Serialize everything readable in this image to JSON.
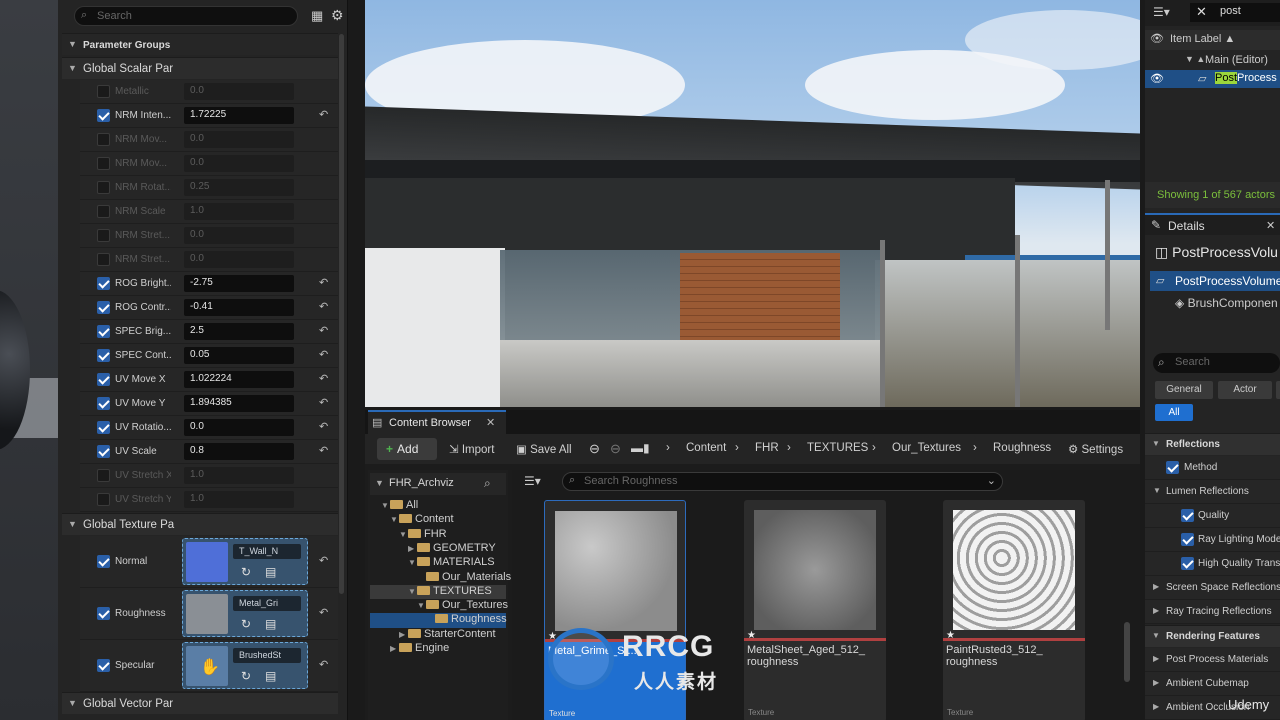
{
  "material_panel": {
    "search_placeholder": "Search",
    "parameter_groups": "Parameter Groups",
    "global_scalar": "Global Scalar Par",
    "global_texture": "Global Texture Pa",
    "global_vector": "Global Vector Par",
    "scalar_params": [
      {
        "label": "Metallic",
        "value": "0.0",
        "enabled": false
      },
      {
        "label": "NRM Inten...",
        "value": "1.72225",
        "enabled": true
      },
      {
        "label": "NRM Mov...",
        "value": "0.0",
        "enabled": false
      },
      {
        "label": "NRM Mov...",
        "value": "0.0",
        "enabled": false
      },
      {
        "label": "NRM Rotat...",
        "value": "0.25",
        "enabled": false
      },
      {
        "label": "NRM Scale",
        "value": "1.0",
        "enabled": false
      },
      {
        "label": "NRM Stret...",
        "value": "0.0",
        "enabled": false
      },
      {
        "label": "NRM Stret...",
        "value": "0.0",
        "enabled": false
      },
      {
        "label": "ROG Bright...",
        "value": "-2.75",
        "enabled": true
      },
      {
        "label": "ROG Contr...",
        "value": "-0.41",
        "enabled": true
      },
      {
        "label": "SPEC Brig...",
        "value": "2.5",
        "enabled": true
      },
      {
        "label": "SPEC Cont...",
        "value": "0.05",
        "enabled": true
      },
      {
        "label": "UV Move X",
        "value": "1.022224",
        "enabled": true
      },
      {
        "label": "UV Move Y",
        "value": "1.894385",
        "enabled": true
      },
      {
        "label": "UV Rotatio...",
        "value": "0.0",
        "enabled": true
      },
      {
        "label": "UV Scale",
        "value": "0.8",
        "enabled": true
      },
      {
        "label": "UV Stretch X",
        "value": "1.0",
        "enabled": false
      },
      {
        "label": "UV Stretch Y",
        "value": "1.0",
        "enabled": false
      }
    ],
    "texture_params": [
      {
        "label": "Normal",
        "texture": "T_Wall_N",
        "swatch": "#4f6fd8"
      },
      {
        "label": "Roughness",
        "texture": "Metal_Gri",
        "swatch": "#8a8f95"
      },
      {
        "label": "Specular",
        "texture": "BrushedSt",
        "swatch": "#5a7ea6"
      }
    ]
  },
  "content_browser": {
    "tab_label": "Content Browser",
    "add_label": "Add",
    "import_label": "Import",
    "save_all_label": "Save All",
    "breadcrumb": [
      "Content",
      "FHR",
      "TEXTURES",
      "Our_Textures",
      "Roughness"
    ],
    "settings_label": "Settings",
    "tree_root": "FHR_Archviz",
    "tree": [
      {
        "label": "All",
        "depth": 0,
        "arrow": "▼"
      },
      {
        "label": "Content",
        "depth": 1,
        "arrow": "▼"
      },
      {
        "label": "FHR",
        "depth": 2,
        "arrow": "▼"
      },
      {
        "label": "GEOMETRY",
        "depth": 3,
        "arrow": "▶"
      },
      {
        "label": "MATERIALS",
        "depth": 3,
        "arrow": "▼"
      },
      {
        "label": "Our_Materials",
        "depth": 4,
        "arrow": ""
      },
      {
        "label": "TEXTURES",
        "depth": 3,
        "arrow": "▼"
      },
      {
        "label": "Our_Textures",
        "depth": 4,
        "arrow": "▼"
      },
      {
        "label": "Roughness",
        "depth": 5,
        "arrow": ""
      },
      {
        "label": "StarterContent",
        "depth": 2,
        "arrow": "▶"
      },
      {
        "label": "Engine",
        "depth": 1,
        "arrow": "▶"
      }
    ],
    "search_placeholder": "Search Roughness",
    "assets": [
      {
        "name": "Metal_Grime_St...",
        "type": "Texture"
      },
      {
        "name": "MetalSheet_Aged_512_ roughness",
        "type": "Texture"
      },
      {
        "name": "PaintRusted3_512_ roughness",
        "type": "Texture"
      }
    ]
  },
  "outliner": {
    "search_value": "post",
    "column_label": "Item Label ▲",
    "main_label": "Main (Editor)",
    "highlight": "Post",
    "rest": "Process",
    "showing": "Showing 1 of 567 actors"
  },
  "details": {
    "tab_label": "Details",
    "title": "PostProcessVolu",
    "component_selected": "PostProcessVolume",
    "component_child": "BrushComponen",
    "search_placeholder": "Search",
    "tabs": [
      "General",
      "Actor"
    ],
    "all_label": "All",
    "reflections": "Reflections",
    "method": "Method",
    "lumen_reflections": "Lumen Reflections",
    "quality": "Quality",
    "ray_lighting": "Ray Lighting Mode",
    "high_quality": "High Quality Trans",
    "ssr": "Screen Space Reflections",
    "rtr": "Ray Tracing Reflections",
    "rendering_features": "Rendering Features",
    "pp_materials": "Post Process Materials",
    "ambient_cubemap": "Ambient Cubemap",
    "ambient_occlusion": "Ambient Occlusion"
  },
  "watermark": {
    "brand": "RRCG",
    "sub": "人人素材",
    "udemy": "Udemy"
  }
}
